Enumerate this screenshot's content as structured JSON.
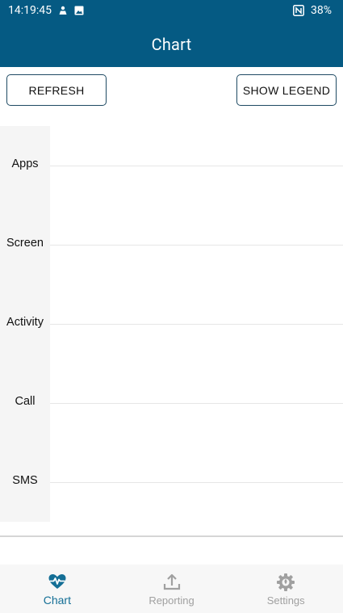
{
  "statusbar": {
    "time": "14:19:45",
    "battery": "38%",
    "icons": [
      "notification-person-icon",
      "image-notification-icon",
      "nfc-icon"
    ]
  },
  "appbar": {
    "title": "Chart"
  },
  "toolbar": {
    "refresh_label": "REFRESH",
    "legend_label": "SHOW LEGEND"
  },
  "chart_data": {
    "type": "bar",
    "orientation": "horizontal",
    "categories": [
      "Apps",
      "Screen",
      "Activity",
      "Call",
      "SMS"
    ],
    "series": [],
    "grid": true,
    "legend": "hidden"
  },
  "nav": {
    "items": [
      {
        "label": "Chart",
        "icon": "heart-pulse-icon",
        "active": true
      },
      {
        "label": "Reporting",
        "icon": "upload-icon",
        "active": false
      },
      {
        "label": "Settings",
        "icon": "gear-icon",
        "active": false
      }
    ]
  },
  "colors": {
    "primary": "#055a83",
    "active": "#146f96",
    "inactive": "#a0a0a0"
  }
}
